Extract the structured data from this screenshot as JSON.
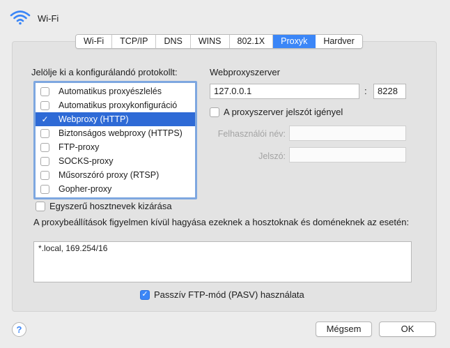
{
  "header": {
    "title": "Wi-Fi",
    "icon": "wifi-icon"
  },
  "tabs": [
    {
      "label": "Wi-Fi"
    },
    {
      "label": "TCP/IP"
    },
    {
      "label": "DNS"
    },
    {
      "label": "WINS"
    },
    {
      "label": "802.1X"
    },
    {
      "label": "Proxyk",
      "active": true
    },
    {
      "label": "Hardver"
    }
  ],
  "protocols": {
    "label": "Jelölje ki a konfigurálandó protokollt:",
    "items": [
      {
        "label": "Automatikus proxyészlelés",
        "checked": false,
        "selected": false
      },
      {
        "label": "Automatikus proxykonfiguráció",
        "checked": false,
        "selected": false
      },
      {
        "label": "Webproxy (HTTP)",
        "checked": true,
        "selected": true
      },
      {
        "label": "Biztonságos webproxy (HTTPS)",
        "checked": false,
        "selected": false
      },
      {
        "label": "FTP-proxy",
        "checked": false,
        "selected": false
      },
      {
        "label": "SOCKS-proxy",
        "checked": false,
        "selected": false
      },
      {
        "label": "Műsorszóró proxy (RTSP)",
        "checked": false,
        "selected": false
      },
      {
        "label": "Gopher-proxy",
        "checked": false,
        "selected": false
      }
    ]
  },
  "server": {
    "label": "Webproxyszerver",
    "host": "127.0.0.1",
    "separator": ":",
    "port": "8228",
    "password_required_label": "A proxyszerver jelszót igényel",
    "password_required": false,
    "username_label": "Felhasználói név:",
    "username_value": "",
    "password_label": "Jelszó:",
    "password_value": ""
  },
  "simple_hosts": {
    "label": "Egyszerű hosztnevek kizárása",
    "checked": false
  },
  "bypass": {
    "label": "A proxybeállítások figyelmen kívül hagyása ezeknek a hosztoknak és doméneknek az esetén:",
    "value": "*.local, 169.254/16"
  },
  "pasv": {
    "label": "Passzív FTP-mód (PASV) használata",
    "checked": true
  },
  "footer": {
    "help": "?",
    "cancel": "Mégsem",
    "ok": "OK"
  },
  "colors": {
    "accent": "#3b86f7",
    "selection": "#2e6ad6",
    "focus_ring": "#7ea7e0"
  }
}
